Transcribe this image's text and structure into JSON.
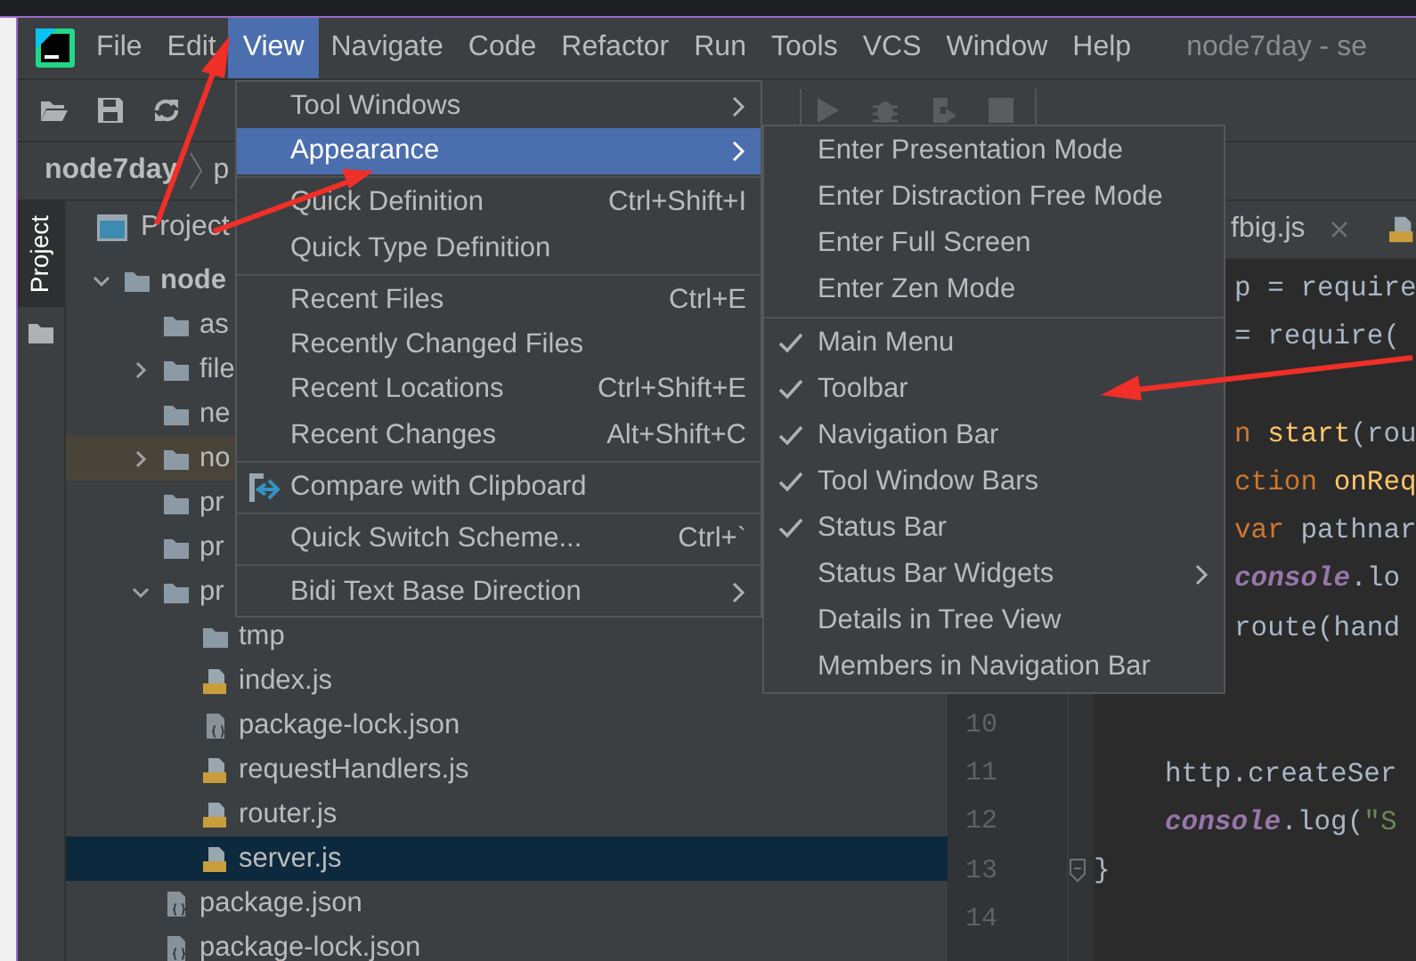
{
  "menu_bar": {
    "items": [
      {
        "label": "File",
        "selected": false
      },
      {
        "label": "Edit",
        "selected": false
      },
      {
        "label": "View",
        "selected": true
      },
      {
        "label": "Navigate",
        "selected": false
      },
      {
        "label": "Code",
        "selected": false
      },
      {
        "label": "Refactor",
        "selected": false
      },
      {
        "label": "Run",
        "selected": false
      },
      {
        "label": "Tools",
        "selected": false
      },
      {
        "label": "VCS",
        "selected": false
      },
      {
        "label": "Window",
        "selected": false
      },
      {
        "label": "Help",
        "selected": false
      }
    ],
    "window_title": "node7day - se"
  },
  "navigation_bar": {
    "crumbs": [
      "node7day",
      "p"
    ]
  },
  "tool_window_stripe": {
    "tabs": [
      {
        "label": "Project",
        "selected": true
      }
    ]
  },
  "project_panel": {
    "title": "Project",
    "tree": [
      {
        "label": "node",
        "kind": "root-folder",
        "expandable": true,
        "expanded": true,
        "selected": false,
        "highlighted": false,
        "children": [
          {
            "label": "as",
            "kind": "folder",
            "expandable": false,
            "selected": false,
            "highlighted": false
          },
          {
            "label": "file",
            "kind": "folder",
            "expandable": true,
            "expanded": false,
            "selected": false,
            "highlighted": false
          },
          {
            "label": "ne",
            "kind": "folder",
            "expandable": false,
            "selected": false,
            "highlighted": false
          },
          {
            "label": "no",
            "kind": "folder",
            "expandable": true,
            "expanded": false,
            "selected": false,
            "highlighted": true
          },
          {
            "label": "pr",
            "kind": "folder",
            "expandable": false,
            "selected": false,
            "highlighted": false
          },
          {
            "label": "pr",
            "kind": "folder",
            "expandable": false,
            "selected": false,
            "highlighted": false
          },
          {
            "label": "pr",
            "kind": "folder",
            "expandable": true,
            "expanded": true,
            "selected": false,
            "highlighted": false,
            "children": [
              {
                "label": "tmp",
                "kind": "folder",
                "expandable": false,
                "selected": false,
                "highlighted": false
              },
              {
                "label": "index.js",
                "kind": "js",
                "expandable": false,
                "selected": false,
                "highlighted": false
              },
              {
                "label": "package-lock.json",
                "kind": "json",
                "expandable": false,
                "selected": false,
                "highlighted": false
              },
              {
                "label": "requestHandlers.js",
                "kind": "js",
                "expandable": false,
                "selected": false,
                "highlighted": false
              },
              {
                "label": "router.js",
                "kind": "js",
                "expandable": false,
                "selected": false,
                "highlighted": false
              },
              {
                "label": "server.js",
                "kind": "js",
                "expandable": false,
                "selected": true,
                "highlighted": false
              }
            ]
          },
          {
            "label": "package.json",
            "kind": "json",
            "expandable": false,
            "selected": false,
            "highlighted": false
          },
          {
            "label": "package-lock.json",
            "kind": "json",
            "expandable": false,
            "selected": false,
            "highlighted": false
          }
        ]
      }
    ]
  },
  "editor": {
    "tabs": [
      {
        "kind": "text",
        "label": "fbig.js"
      },
      {
        "kind": "icon-only"
      }
    ],
    "lines": [
      {
        "kind": "clipped",
        "tokens": [
          {
            "text": "p = require",
            "kind": "plain"
          }
        ]
      },
      {
        "kind": "clipped",
        "tokens": [
          {
            "text": "= require(",
            "kind": "plain"
          }
        ]
      },
      {
        "kind": "clipped"
      },
      {
        "kind": "clipped",
        "tokens": [
          {
            "text": "n ",
            "kind": "keyword"
          },
          {
            "text": "start",
            "kind": "function"
          },
          {
            "text": "(rou",
            "kind": "plain"
          }
        ]
      },
      {
        "kind": "clipped",
        "tokens": [
          {
            "text": "ction ",
            "kind": "keyword"
          },
          {
            "text": "onReq",
            "kind": "function"
          }
        ]
      },
      {
        "kind": "clipped",
        "tokens": [
          {
            "text": "var",
            "kind": "keyword"
          },
          {
            "text": " pathnar",
            "kind": "plain"
          }
        ]
      },
      {
        "kind": "clipped",
        "tokens": [
          {
            "text": "console",
            "kind": "global"
          },
          {
            "text": ".lo",
            "kind": "plain"
          }
        ]
      },
      {
        "kind": "clipped",
        "tokens": [
          {
            "text": "route(hand",
            "kind": "plain"
          }
        ]
      },
      {
        "kind": "clipped"
      },
      {
        "kind": "full",
        "number": "10"
      },
      {
        "kind": "indented",
        "number": "11",
        "tokens": [
          {
            "text": "http.createSer",
            "kind": "plain"
          }
        ]
      },
      {
        "kind": "indented",
        "number": "12",
        "tokens": [
          {
            "text": "console",
            "kind": "global"
          },
          {
            "text": ".log(",
            "kind": "plain"
          },
          {
            "text": "\"S",
            "kind": "string"
          }
        ]
      },
      {
        "kind": "full",
        "number": "13",
        "fold": true,
        "tokens": [
          {
            "text": "}",
            "kind": "plain"
          }
        ]
      },
      {
        "kind": "full",
        "number": "14"
      }
    ]
  },
  "view_menu": {
    "items": [
      {
        "kind": "item",
        "label": "Tool Windows",
        "submenu": true,
        "selected": false
      },
      {
        "kind": "item",
        "label": "Appearance",
        "submenu": true,
        "selected": true
      },
      {
        "kind": "separator"
      },
      {
        "kind": "item",
        "label": "Quick Definition",
        "shortcut": "Ctrl+Shift+I",
        "submenu": false,
        "selected": false
      },
      {
        "kind": "item",
        "label": "Quick Type Definition",
        "submenu": false,
        "selected": false
      },
      {
        "kind": "separator"
      },
      {
        "kind": "item",
        "label": "Recent Files",
        "shortcut": "Ctrl+E",
        "submenu": false,
        "selected": false
      },
      {
        "kind": "item",
        "label": "Recently Changed Files",
        "submenu": false,
        "selected": false
      },
      {
        "kind": "item",
        "label": "Recent Locations",
        "shortcut": "Ctrl+Shift+E",
        "submenu": false,
        "selected": false
      },
      {
        "kind": "item",
        "label": "Recent Changes",
        "shortcut": "Alt+Shift+C",
        "submenu": false,
        "selected": false
      },
      {
        "kind": "separator"
      },
      {
        "kind": "icon-item",
        "label": "Compare with Clipboard",
        "submenu": false,
        "selected": false
      },
      {
        "kind": "separator"
      },
      {
        "kind": "item",
        "label": "Quick Switch Scheme...",
        "shortcut": "Ctrl+`",
        "submenu": false,
        "selected": false
      },
      {
        "kind": "separator"
      },
      {
        "kind": "item",
        "label": "Bidi Text Base Direction",
        "submenu": true,
        "selected": false
      }
    ]
  },
  "appearance_submenu": {
    "items": [
      {
        "kind": "item",
        "label": "Enter Presentation Mode",
        "checked": false,
        "submenu": false
      },
      {
        "kind": "item",
        "label": "Enter Distraction Free Mode",
        "checked": false,
        "submenu": false
      },
      {
        "kind": "item",
        "label": "Enter Full Screen",
        "checked": false,
        "submenu": false
      },
      {
        "kind": "item",
        "label": "Enter Zen Mode",
        "checked": false,
        "submenu": false
      },
      {
        "kind": "separator"
      },
      {
        "kind": "item",
        "label": "Main Menu",
        "checked": true,
        "submenu": false
      },
      {
        "kind": "item",
        "label": "Toolbar",
        "checked": true,
        "submenu": false
      },
      {
        "kind": "item",
        "label": "Navigation Bar",
        "checked": true,
        "submenu": false
      },
      {
        "kind": "item",
        "label": "Tool Window Bars",
        "checked": true,
        "submenu": false
      },
      {
        "kind": "item",
        "label": "Status Bar",
        "checked": true,
        "submenu": false
      },
      {
        "kind": "item",
        "label": "Status Bar Widgets",
        "checked": false,
        "submenu": true
      },
      {
        "kind": "item",
        "label": "Details in Tree View",
        "checked": false,
        "submenu": false
      },
      {
        "kind": "item",
        "label": "Members in Navigation Bar",
        "checked": false,
        "submenu": false
      }
    ]
  }
}
